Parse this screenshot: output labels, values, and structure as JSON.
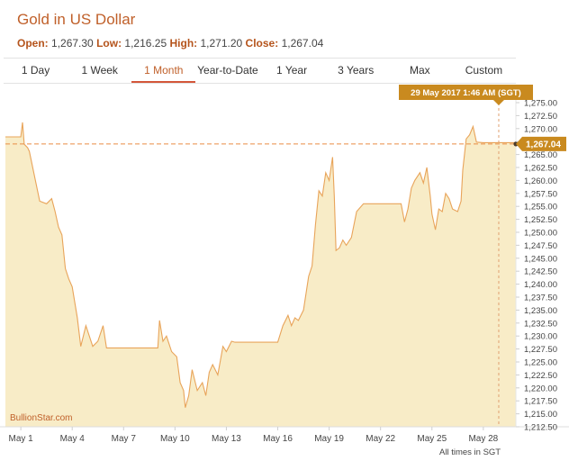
{
  "title": "Gold in US Dollar",
  "ohlc": {
    "open_label": "Open:",
    "open": "1,267.30",
    "low_label": "Low:",
    "low": "1,216.25",
    "high_label": "High:",
    "high": "1,271.20",
    "close_label": "Close:",
    "close": "1,267.04"
  },
  "tabs": [
    {
      "label": "1 Day"
    },
    {
      "label": "1 Week"
    },
    {
      "label": "1 Month",
      "active": true
    },
    {
      "label": "Year-to-Date"
    },
    {
      "label": "1 Year"
    },
    {
      "label": "3 Years"
    },
    {
      "label": "Max"
    },
    {
      "label": "Custom"
    }
  ],
  "chart_data": {
    "type": "area",
    "ylim": [
      1212.5,
      1275.0
    ],
    "y_ticks": [
      "1,212.50",
      "1,215.00",
      "1,217.50",
      "1,220.00",
      "1,222.50",
      "1,225.00",
      "1,227.50",
      "1,230.00",
      "1,232.50",
      "1,235.00",
      "1,237.50",
      "1,240.00",
      "1,242.50",
      "1,245.00",
      "1,247.50",
      "1,250.00",
      "1,252.50",
      "1,255.00",
      "1,257.50",
      "1,260.00",
      "1,262.50",
      "1,265.00",
      "1,267.50",
      "1,270.00",
      "1,272.50",
      "1,275.00"
    ],
    "x_ticks": [
      "May 1",
      "May 4",
      "May 7",
      "May 10",
      "May 13",
      "May 16",
      "May 19",
      "May 22",
      "May 25",
      "May 28"
    ],
    "x_range_days": [
      -0.9,
      28.9
    ],
    "series": [
      {
        "points": [
          [
            -0.9,
            1268.4
          ],
          [
            0.0,
            1268.4
          ],
          [
            0.1,
            1271.2
          ],
          [
            0.2,
            1267.0
          ],
          [
            0.4,
            1266.3
          ],
          [
            0.5,
            1265.6
          ],
          [
            1.1,
            1256.0
          ],
          [
            1.5,
            1255.5
          ],
          [
            1.8,
            1256.5
          ],
          [
            2.0,
            1254.0
          ],
          [
            2.2,
            1251.0
          ],
          [
            2.4,
            1249.5
          ],
          [
            2.6,
            1243.0
          ],
          [
            2.8,
            1241.0
          ],
          [
            3.0,
            1239.5
          ],
          [
            3.3,
            1233.5
          ],
          [
            3.5,
            1228.0
          ],
          [
            3.8,
            1232.0
          ],
          [
            4.0,
            1230.0
          ],
          [
            4.2,
            1228.0
          ],
          [
            4.5,
            1229.0
          ],
          [
            4.8,
            1232.0
          ],
          [
            5.0,
            1227.7
          ],
          [
            6.0,
            1227.7
          ],
          [
            7.0,
            1227.7
          ],
          [
            8.0,
            1227.7
          ],
          [
            8.1,
            1233.0
          ],
          [
            8.3,
            1229.0
          ],
          [
            8.5,
            1230.0
          ],
          [
            8.8,
            1227.0
          ],
          [
            9.1,
            1226.0
          ],
          [
            9.3,
            1221.0
          ],
          [
            9.5,
            1219.5
          ],
          [
            9.6,
            1216.2
          ],
          [
            9.8,
            1218.5
          ],
          [
            10.0,
            1223.5
          ],
          [
            10.3,
            1219.5
          ],
          [
            10.6,
            1221.0
          ],
          [
            10.8,
            1218.5
          ],
          [
            11.0,
            1223.0
          ],
          [
            11.2,
            1224.5
          ],
          [
            11.5,
            1222.5
          ],
          [
            11.8,
            1228.0
          ],
          [
            12.0,
            1227.0
          ],
          [
            12.3,
            1229.0
          ],
          [
            12.5,
            1228.8
          ],
          [
            13.0,
            1228.8
          ],
          [
            14.0,
            1228.8
          ],
          [
            15.0,
            1228.8
          ],
          [
            15.3,
            1232.0
          ],
          [
            15.6,
            1234.0
          ],
          [
            15.8,
            1232.0
          ],
          [
            16.0,
            1233.5
          ],
          [
            16.2,
            1233.0
          ],
          [
            16.5,
            1235.0
          ],
          [
            16.8,
            1241.5
          ],
          [
            17.0,
            1243.5
          ],
          [
            17.2,
            1251.5
          ],
          [
            17.4,
            1258.0
          ],
          [
            17.6,
            1257.0
          ],
          [
            17.8,
            1261.5
          ],
          [
            18.0,
            1260.0
          ],
          [
            18.2,
            1264.5
          ],
          [
            18.3,
            1257.0
          ],
          [
            18.4,
            1246.5
          ],
          [
            18.6,
            1247.0
          ],
          [
            18.8,
            1248.5
          ],
          [
            19.0,
            1247.5
          ],
          [
            19.3,
            1249.0
          ],
          [
            19.6,
            1254.0
          ],
          [
            20.0,
            1255.5
          ],
          [
            21.0,
            1255.5
          ],
          [
            22.0,
            1255.5
          ],
          [
            22.2,
            1255.5
          ],
          [
            22.4,
            1252.0
          ],
          [
            22.6,
            1254.5
          ],
          [
            22.8,
            1258.5
          ],
          [
            23.0,
            1260.0
          ],
          [
            23.3,
            1261.5
          ],
          [
            23.5,
            1259.5
          ],
          [
            23.7,
            1262.5
          ],
          [
            23.9,
            1257.0
          ],
          [
            24.0,
            1253.5
          ],
          [
            24.2,
            1250.5
          ],
          [
            24.4,
            1254.5
          ],
          [
            24.6,
            1254.0
          ],
          [
            24.8,
            1257.5
          ],
          [
            25.0,
            1256.5
          ],
          [
            25.2,
            1254.5
          ],
          [
            25.5,
            1254.0
          ],
          [
            25.7,
            1256.0
          ],
          [
            25.8,
            1262.0
          ],
          [
            26.0,
            1268.0
          ],
          [
            26.2,
            1268.8
          ],
          [
            26.4,
            1270.4
          ],
          [
            26.6,
            1267.4
          ],
          [
            27.0,
            1267.3
          ],
          [
            28.0,
            1267.3
          ],
          [
            28.9,
            1267.3
          ]
        ]
      }
    ],
    "last_value_label": "1,267.04",
    "last_value": 1267.04,
    "tooltip_date": "29 May 2017 1:46 AM (SGT)",
    "tooltip_x_day": 27.9,
    "watermark": "BullionStar.com",
    "footnote": "All times in SGT",
    "colors": {
      "line": "#e8a45a",
      "fill": "#f8ecc7",
      "accent": "#c98a1f",
      "title": "#c0602a"
    }
  }
}
